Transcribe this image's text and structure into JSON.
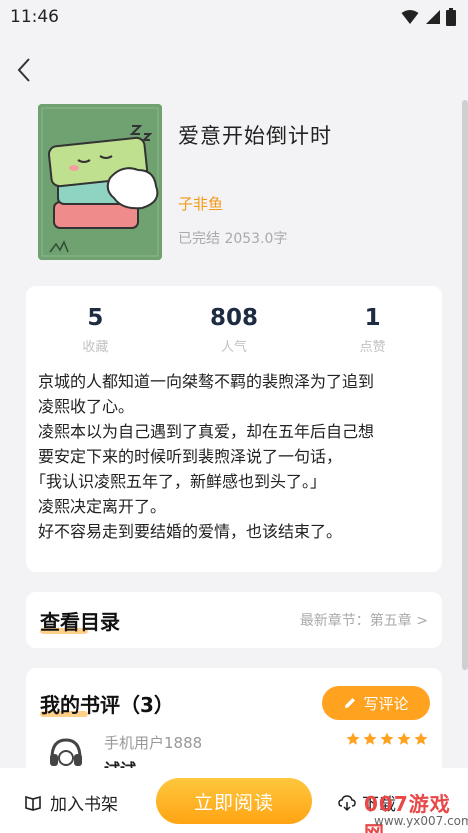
{
  "status_bar": {
    "time": "11:46"
  },
  "book": {
    "title": "爱意开始倒计时",
    "author": "子非鱼",
    "status": "已完结 2053.0字"
  },
  "stats": [
    {
      "value": "5",
      "label": "收藏"
    },
    {
      "value": "808",
      "label": "人气"
    },
    {
      "value": "1",
      "label": "点赞"
    }
  ],
  "synopsis": [
    "京城的人都知道一向桀骜不羁的裴煦泽为了追到",
    "凌熙收了心。",
    "凌熙本以为自己遇到了真爱，却在五年后自己想",
    "要安定下来的时候听到裴煦泽说了一句话，",
    "「我认识凌熙五年了，新鲜感也到头了。」",
    "凌熙决定离开了。",
    "好不容易走到要结婚的爱情，也该结束了。"
  ],
  "catalog": {
    "title": "查看目录",
    "latest": "最新章节：第五章 >"
  },
  "reviews": {
    "title": "我的书评（3）",
    "write_label": "写评论",
    "items": [
      {
        "user": "手机用户1888",
        "text": "试试",
        "rating": 5
      }
    ]
  },
  "bottom_bar": {
    "shelf_label": "加入书架",
    "read_label": "立即阅读",
    "download_label": "下载"
  },
  "watermark": {
    "main": "007游戏网",
    "url": "www.yx007.com"
  },
  "colors": {
    "accent": "#ffa21f",
    "author": "#f29a1a",
    "stat_value": "#1d2b43",
    "watermark": "#e84848"
  }
}
